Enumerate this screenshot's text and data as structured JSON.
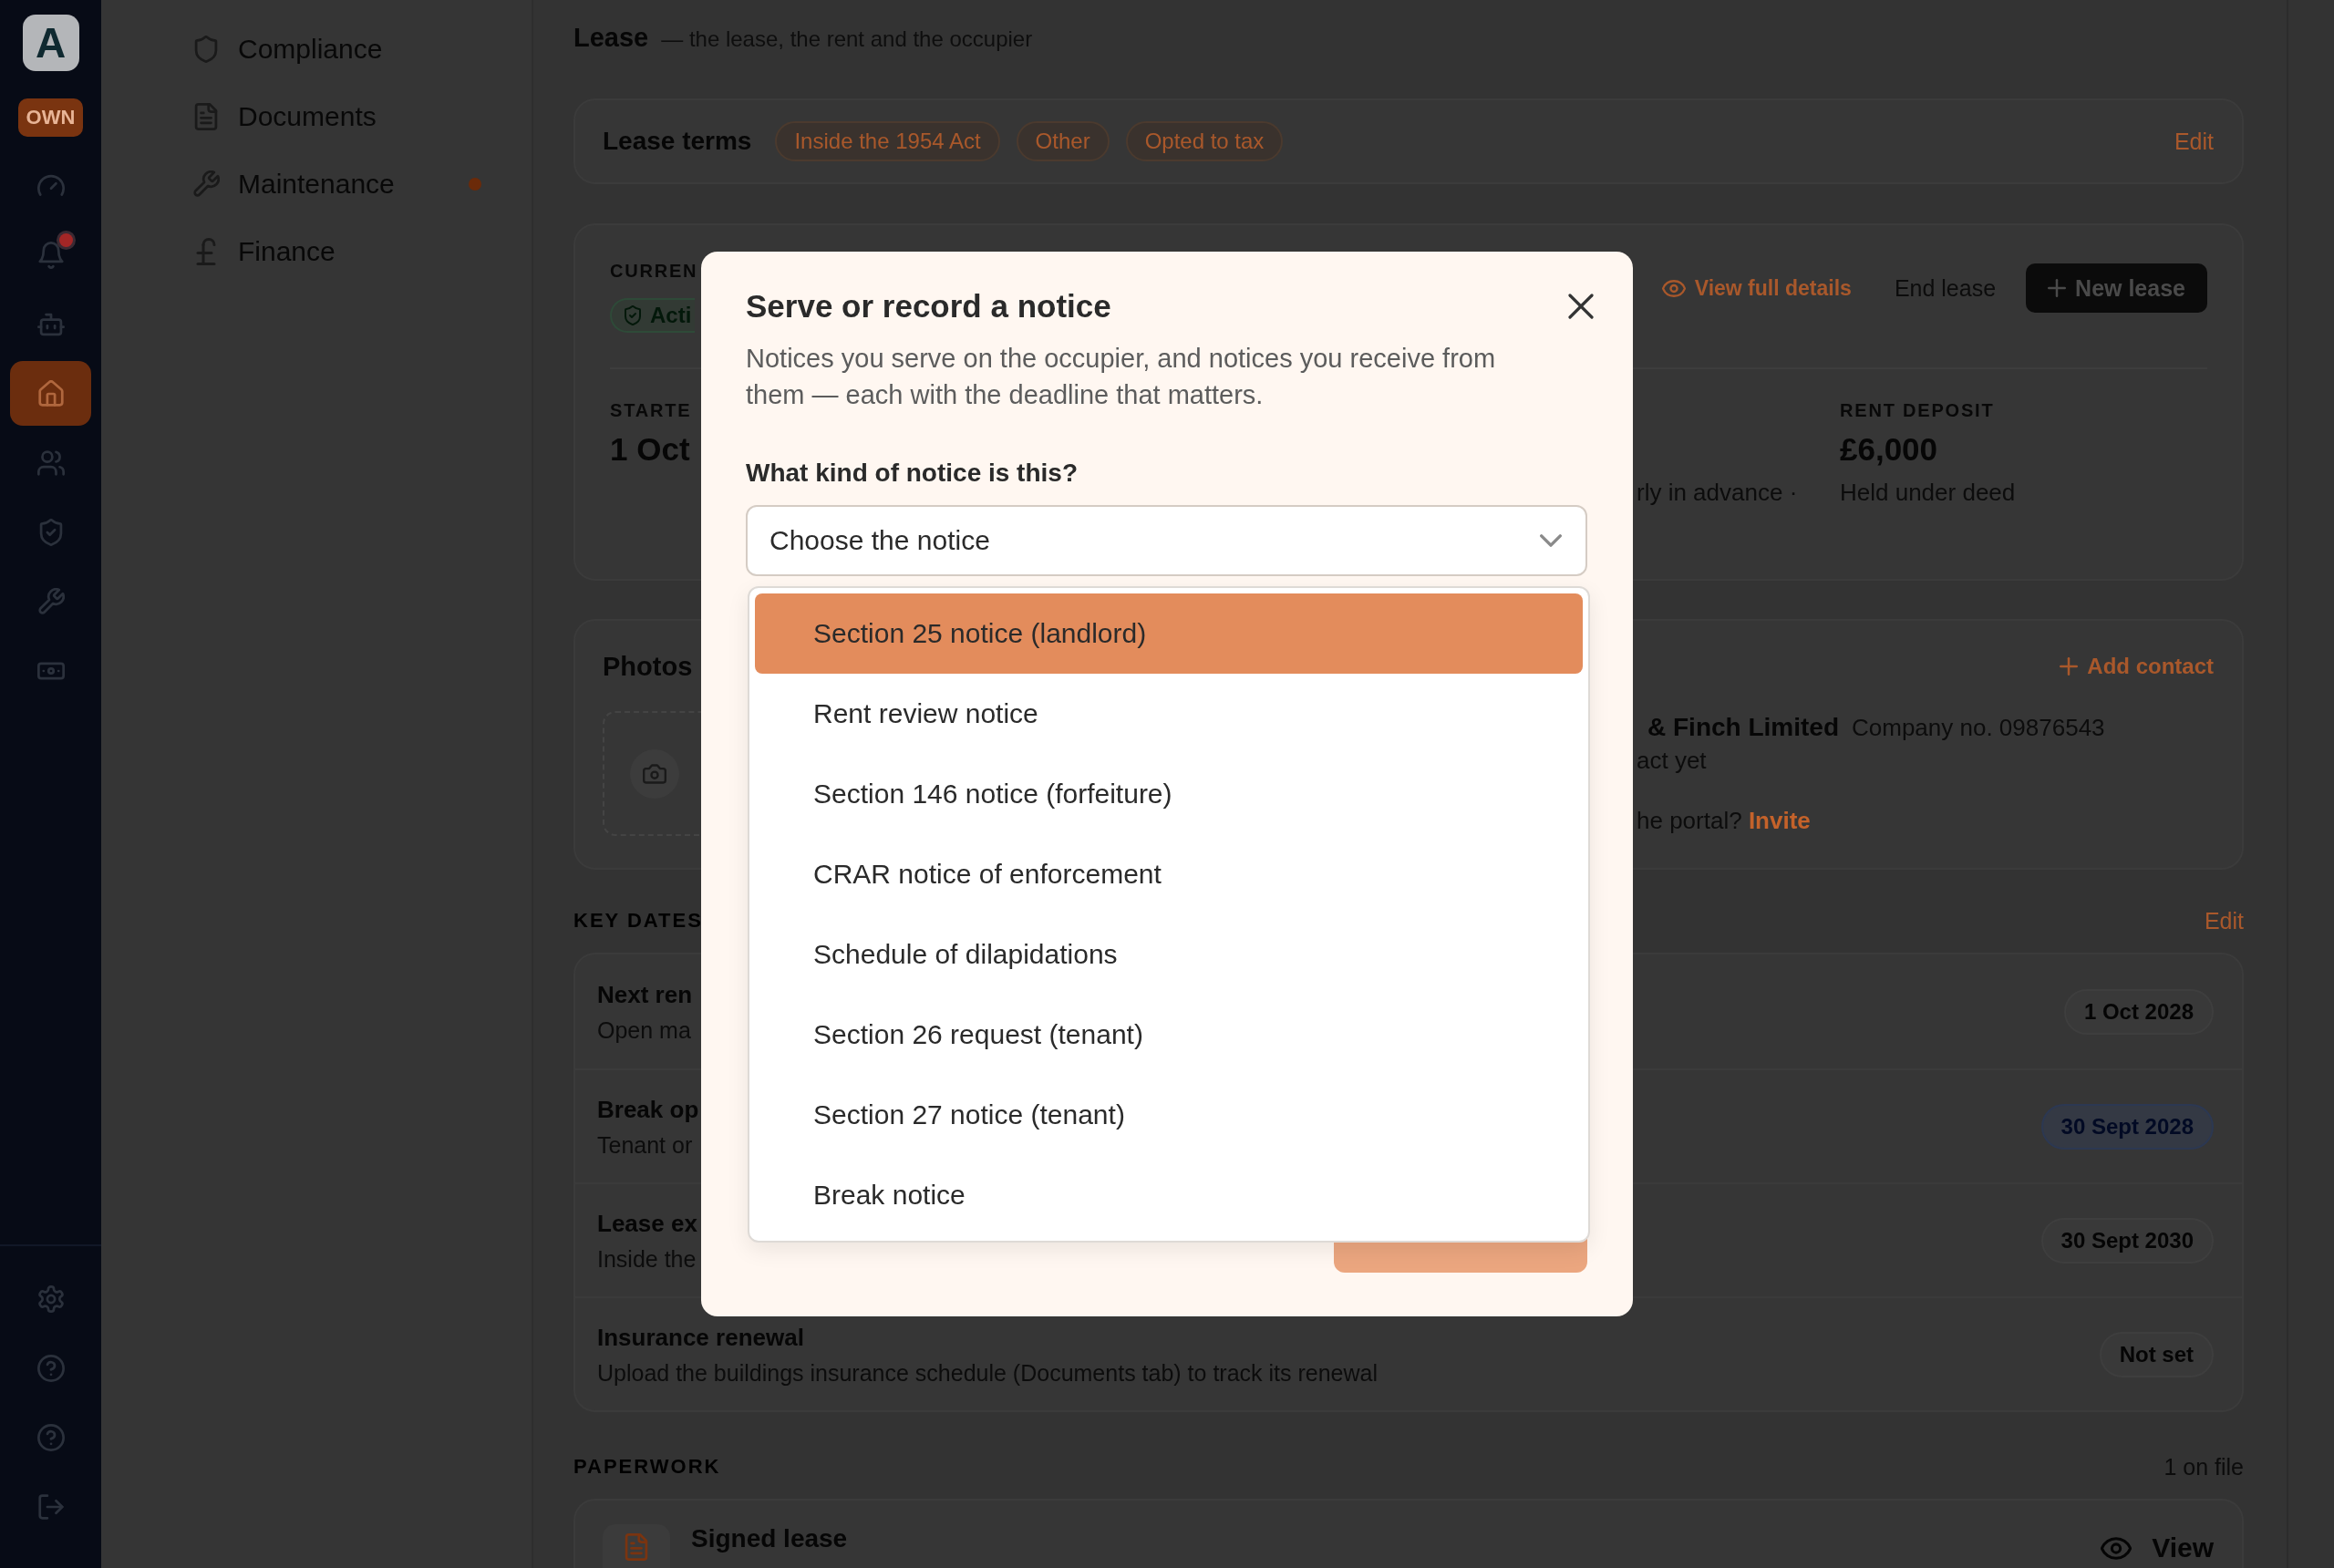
{
  "rail": {
    "logo": "A",
    "badge": "OWN",
    "items": [
      {
        "kind": "gauge",
        "selected": false,
        "alert": false
      },
      {
        "kind": "bell",
        "selected": false,
        "alert": true
      },
      {
        "kind": "robot",
        "selected": false,
        "alert": false
      },
      {
        "kind": "home",
        "selected": true,
        "alert": false
      },
      {
        "kind": "users",
        "selected": false,
        "alert": false
      },
      {
        "kind": "shieldcheck",
        "selected": false,
        "alert": false
      },
      {
        "kind": "wrench",
        "selected": false,
        "alert": false
      },
      {
        "kind": "cash",
        "selected": false,
        "alert": false
      }
    ],
    "footer_items": [
      {
        "kind": "gear"
      },
      {
        "kind": "help"
      },
      {
        "kind": "help"
      },
      {
        "kind": "logout"
      }
    ]
  },
  "section_nav": [
    {
      "kind": "shield",
      "label": "Compliance",
      "alert": false
    },
    {
      "kind": "document",
      "label": "Documents",
      "alert": false
    },
    {
      "kind": "wrench",
      "label": "Maintenance",
      "alert": true
    },
    {
      "kind": "pound",
      "label": "Finance",
      "alert": false
    }
  ],
  "page": {
    "title": "Lease",
    "subtitle": "— the lease, the rent and the occupier"
  },
  "lease_terms": {
    "title": "Lease terms",
    "tags": [
      "Inside the 1954 Act",
      "Other",
      "Opted to tax"
    ],
    "edit": "Edit"
  },
  "current_lease": {
    "label": "CURREN",
    "status": "Acti",
    "view": "View full details",
    "end": "End lease",
    "new": "New lease",
    "stats": [
      {
        "label": "STARTE",
        "value": "1 Oct"
      },
      {
        "note": "rly in advance ·"
      },
      {
        "label": "RENT DEPOSIT",
        "value": "£6,000",
        "note": "Held under deed"
      }
    ]
  },
  "photos": {
    "title": "Photos"
  },
  "occupier": {
    "add": "Add contact",
    "name": "& Finch Limited",
    "company": "Company no. 09876543",
    "contact": "act yet",
    "portal": "he portal?",
    "invite": "Invite"
  },
  "key_dates": {
    "title": "KEY DATES",
    "edit": "Edit",
    "rows": [
      {
        "title": "Next ren",
        "note": "Open ma",
        "date": "1 Oct 2028",
        "kind": "neutral"
      },
      {
        "title": "Break op",
        "note": "Tenant or",
        "date": "30 Sept 2028",
        "kind": "upcoming"
      },
      {
        "title": "Lease ex",
        "note": "Inside the",
        "date": "30 Sept 2030",
        "kind": "neutral"
      },
      {
        "title": "Insurance renewal",
        "note": "Upload the buildings insurance schedule (Documents tab) to track its renewal",
        "date": "Not set",
        "kind": "neutral"
      }
    ]
  },
  "paperwork": {
    "title": "PAPERWORK",
    "count": "1 on file",
    "items": [
      {
        "title": "Signed lease",
        "action": "View"
      }
    ]
  },
  "dialog": {
    "title": "Serve or record a notice",
    "description": "Notices you serve on the occupier, and notices you receive from them — each with the deadline that matters.",
    "question": "What kind of notice is this?",
    "select": {
      "placeholder": "Choose the notice",
      "expanded": true
    },
    "options": [
      {
        "label": "Section 25 notice (landlord)",
        "selected": true
      },
      {
        "label": "Rent review notice",
        "selected": false
      },
      {
        "label": "Section 146 notice (forfeiture)",
        "selected": false
      },
      {
        "label": "CRAR notice of enforcement",
        "selected": false
      },
      {
        "label": "Schedule of dilapidations",
        "selected": false
      },
      {
        "label": "Section 26 request (tenant)",
        "selected": false
      },
      {
        "label": "Section 27 notice (tenant)",
        "selected": false
      },
      {
        "label": "Break notice",
        "selected": false
      }
    ],
    "submit": {
      "disabled": true
    }
  }
}
